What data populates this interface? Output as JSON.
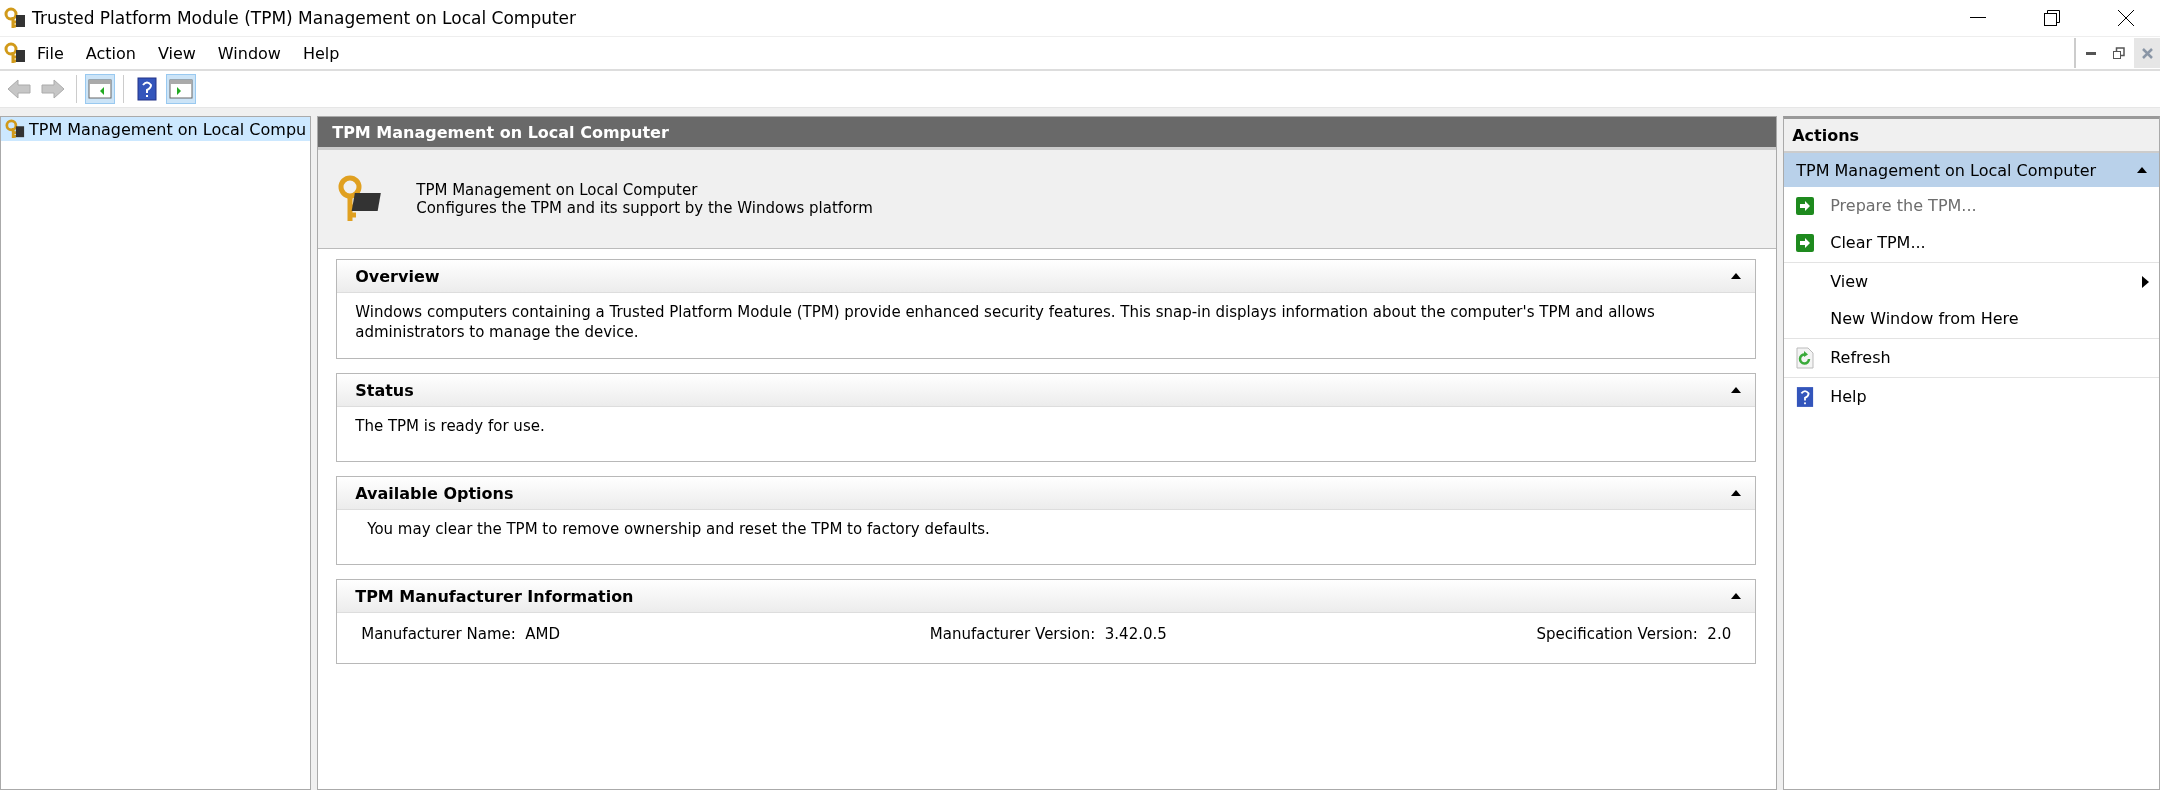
{
  "window": {
    "title": "Trusted Platform Module (TPM) Management on Local Computer"
  },
  "menu": [
    "File",
    "Action",
    "View",
    "Window",
    "Help"
  ],
  "toolbar": [
    {
      "kind": "back",
      "disabled": true,
      "pressed": false
    },
    {
      "kind": "forward",
      "disabled": true,
      "pressed": false
    },
    {
      "kind": "tree",
      "disabled": false,
      "pressed": true
    },
    {
      "kind": "help",
      "disabled": false,
      "pressed": false
    },
    {
      "kind": "actionpane",
      "disabled": false,
      "pressed": true
    }
  ],
  "tree": [
    {
      "label": "TPM Management on Local Compu",
      "selected": true
    }
  ],
  "center": {
    "header": "TPM Management on Local Computer",
    "intro": {
      "title": "TPM Management on Local Computer",
      "description": "Configures the TPM and its support by the Windows platform"
    },
    "sections": [
      {
        "kind": "text",
        "title": "Overview",
        "expanded": true,
        "text": "Windows computers containing a Trusted Platform Module (TPM) provide enhanced security features. This snap-in displays information about the computer's TPM and allows administrators to manage the device."
      },
      {
        "kind": "text",
        "title": "Status",
        "expanded": true,
        "text": "The TPM is ready for use."
      },
      {
        "kind": "option",
        "title": "Available Options",
        "expanded": true,
        "text": "You may clear the TPM to remove ownership and reset the TPM to factory defaults."
      },
      {
        "kind": "fields",
        "title": "TPM Manufacturer Information",
        "expanded": true,
        "fields": [
          {
            "label": "Manufacturer Name:",
            "value": "AMD"
          },
          {
            "label": "Manufacturer Version:",
            "value": "3.42.0.5"
          },
          {
            "label": "Specification Version:",
            "value": "2.0"
          }
        ]
      }
    ]
  },
  "actions": {
    "header": "Actions",
    "group": {
      "title": "TPM Management on Local Computer",
      "expanded": true
    },
    "items": [
      {
        "kind": "go",
        "label": "Prepare the TPM...",
        "disabled": true,
        "separator_before": false,
        "submenu": false
      },
      {
        "kind": "go",
        "label": "Clear TPM...",
        "disabled": false,
        "separator_before": false,
        "submenu": false
      },
      {
        "kind": "none",
        "label": "View",
        "disabled": false,
        "separator_before": true,
        "submenu": true
      },
      {
        "kind": "none",
        "label": "New Window from Here",
        "disabled": false,
        "separator_before": false,
        "submenu": false
      },
      {
        "kind": "refresh",
        "label": "Refresh",
        "disabled": false,
        "separator_before": true,
        "submenu": false
      },
      {
        "kind": "help",
        "label": "Help",
        "disabled": false,
        "separator_before": true,
        "submenu": false
      }
    ]
  }
}
